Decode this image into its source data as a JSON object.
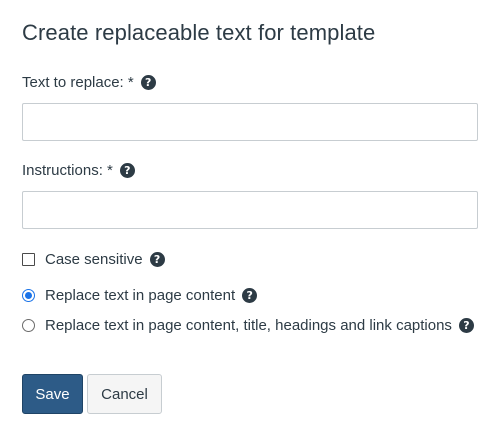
{
  "dialog": {
    "title": "Create replaceable text for template"
  },
  "fields": {
    "text_to_replace": {
      "label": "Text to replace: *",
      "value": "",
      "help_icon": "question-circle-icon"
    },
    "instructions": {
      "label": "Instructions: *",
      "value": "",
      "help_icon": "question-circle-icon"
    }
  },
  "options": {
    "case_sensitive": {
      "label": "Case sensitive",
      "checked": false,
      "help_icon": "question-circle-icon"
    },
    "scope": {
      "selected": "page_content",
      "choices": [
        {
          "id": "page_content",
          "label": "Replace text in page content"
        },
        {
          "id": "all",
          "label": "Replace text in page content, title, headings and link captions"
        }
      ]
    }
  },
  "buttons": {
    "save_label": "Save",
    "cancel_label": "Cancel"
  },
  "colors": {
    "text": "#2d3b45",
    "primary": "#2d5b87",
    "radio_selected": "#1a73e8",
    "input_border": "#c7cdd1"
  }
}
